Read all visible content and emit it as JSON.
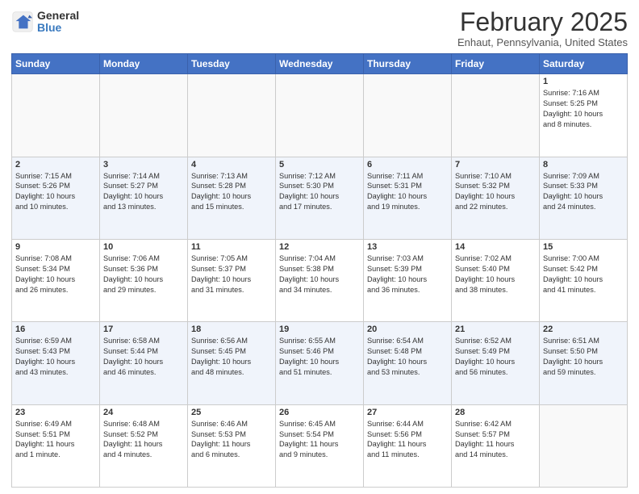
{
  "header": {
    "logo_general": "General",
    "logo_blue": "Blue",
    "month_title": "February 2025",
    "location": "Enhaut, Pennsylvania, United States"
  },
  "days_of_week": [
    "Sunday",
    "Monday",
    "Tuesday",
    "Wednesday",
    "Thursday",
    "Friday",
    "Saturday"
  ],
  "weeks": [
    [
      {
        "day": "",
        "info": ""
      },
      {
        "day": "",
        "info": ""
      },
      {
        "day": "",
        "info": ""
      },
      {
        "day": "",
        "info": ""
      },
      {
        "day": "",
        "info": ""
      },
      {
        "day": "",
        "info": ""
      },
      {
        "day": "1",
        "info": "Sunrise: 7:16 AM\nSunset: 5:25 PM\nDaylight: 10 hours\nand 8 minutes."
      }
    ],
    [
      {
        "day": "2",
        "info": "Sunrise: 7:15 AM\nSunset: 5:26 PM\nDaylight: 10 hours\nand 10 minutes."
      },
      {
        "day": "3",
        "info": "Sunrise: 7:14 AM\nSunset: 5:27 PM\nDaylight: 10 hours\nand 13 minutes."
      },
      {
        "day": "4",
        "info": "Sunrise: 7:13 AM\nSunset: 5:28 PM\nDaylight: 10 hours\nand 15 minutes."
      },
      {
        "day": "5",
        "info": "Sunrise: 7:12 AM\nSunset: 5:30 PM\nDaylight: 10 hours\nand 17 minutes."
      },
      {
        "day": "6",
        "info": "Sunrise: 7:11 AM\nSunset: 5:31 PM\nDaylight: 10 hours\nand 19 minutes."
      },
      {
        "day": "7",
        "info": "Sunrise: 7:10 AM\nSunset: 5:32 PM\nDaylight: 10 hours\nand 22 minutes."
      },
      {
        "day": "8",
        "info": "Sunrise: 7:09 AM\nSunset: 5:33 PM\nDaylight: 10 hours\nand 24 minutes."
      }
    ],
    [
      {
        "day": "9",
        "info": "Sunrise: 7:08 AM\nSunset: 5:34 PM\nDaylight: 10 hours\nand 26 minutes."
      },
      {
        "day": "10",
        "info": "Sunrise: 7:06 AM\nSunset: 5:36 PM\nDaylight: 10 hours\nand 29 minutes."
      },
      {
        "day": "11",
        "info": "Sunrise: 7:05 AM\nSunset: 5:37 PM\nDaylight: 10 hours\nand 31 minutes."
      },
      {
        "day": "12",
        "info": "Sunrise: 7:04 AM\nSunset: 5:38 PM\nDaylight: 10 hours\nand 34 minutes."
      },
      {
        "day": "13",
        "info": "Sunrise: 7:03 AM\nSunset: 5:39 PM\nDaylight: 10 hours\nand 36 minutes."
      },
      {
        "day": "14",
        "info": "Sunrise: 7:02 AM\nSunset: 5:40 PM\nDaylight: 10 hours\nand 38 minutes."
      },
      {
        "day": "15",
        "info": "Sunrise: 7:00 AM\nSunset: 5:42 PM\nDaylight: 10 hours\nand 41 minutes."
      }
    ],
    [
      {
        "day": "16",
        "info": "Sunrise: 6:59 AM\nSunset: 5:43 PM\nDaylight: 10 hours\nand 43 minutes."
      },
      {
        "day": "17",
        "info": "Sunrise: 6:58 AM\nSunset: 5:44 PM\nDaylight: 10 hours\nand 46 minutes."
      },
      {
        "day": "18",
        "info": "Sunrise: 6:56 AM\nSunset: 5:45 PM\nDaylight: 10 hours\nand 48 minutes."
      },
      {
        "day": "19",
        "info": "Sunrise: 6:55 AM\nSunset: 5:46 PM\nDaylight: 10 hours\nand 51 minutes."
      },
      {
        "day": "20",
        "info": "Sunrise: 6:54 AM\nSunset: 5:48 PM\nDaylight: 10 hours\nand 53 minutes."
      },
      {
        "day": "21",
        "info": "Sunrise: 6:52 AM\nSunset: 5:49 PM\nDaylight: 10 hours\nand 56 minutes."
      },
      {
        "day": "22",
        "info": "Sunrise: 6:51 AM\nSunset: 5:50 PM\nDaylight: 10 hours\nand 59 minutes."
      }
    ],
    [
      {
        "day": "23",
        "info": "Sunrise: 6:49 AM\nSunset: 5:51 PM\nDaylight: 11 hours\nand 1 minute."
      },
      {
        "day": "24",
        "info": "Sunrise: 6:48 AM\nSunset: 5:52 PM\nDaylight: 11 hours\nand 4 minutes."
      },
      {
        "day": "25",
        "info": "Sunrise: 6:46 AM\nSunset: 5:53 PM\nDaylight: 11 hours\nand 6 minutes."
      },
      {
        "day": "26",
        "info": "Sunrise: 6:45 AM\nSunset: 5:54 PM\nDaylight: 11 hours\nand 9 minutes."
      },
      {
        "day": "27",
        "info": "Sunrise: 6:44 AM\nSunset: 5:56 PM\nDaylight: 11 hours\nand 11 minutes."
      },
      {
        "day": "28",
        "info": "Sunrise: 6:42 AM\nSunset: 5:57 PM\nDaylight: 11 hours\nand 14 minutes."
      },
      {
        "day": "",
        "info": ""
      }
    ]
  ]
}
